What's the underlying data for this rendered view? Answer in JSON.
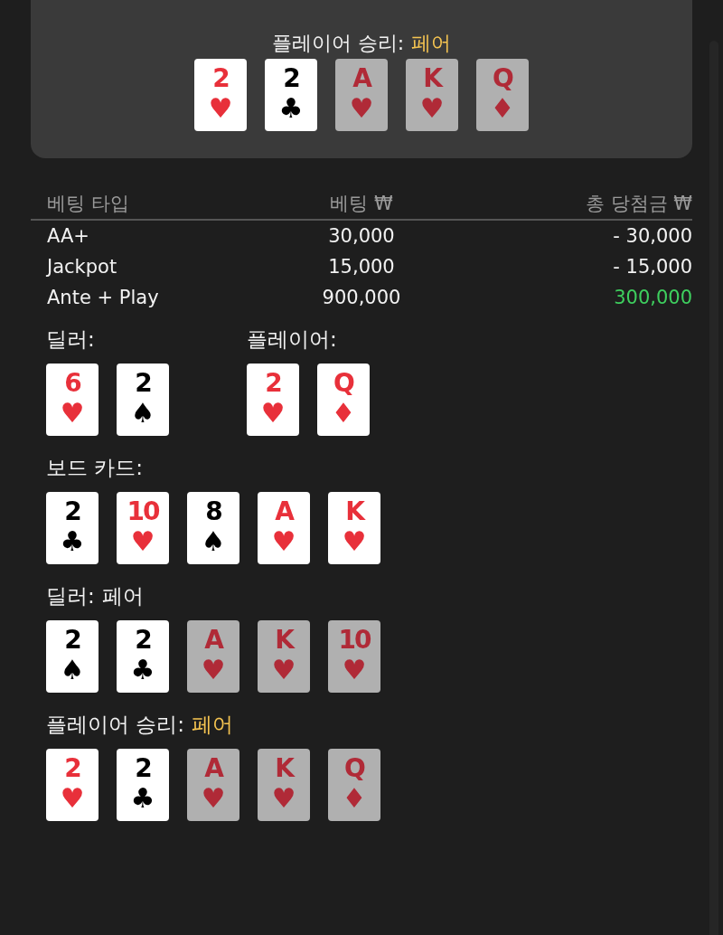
{
  "result_panel": {
    "label": "플레이어 승리:",
    "hand": "페어",
    "cards": [
      {
        "rank": "2",
        "suit": "♥",
        "red": true,
        "dimmed": false
      },
      {
        "rank": "2",
        "suit": "♣",
        "red": false,
        "dimmed": false
      },
      {
        "rank": "A",
        "suit": "♥",
        "red": true,
        "dimmed": true
      },
      {
        "rank": "K",
        "suit": "♥",
        "red": true,
        "dimmed": true
      },
      {
        "rank": "Q",
        "suit": "♦",
        "red": true,
        "dimmed": true
      }
    ]
  },
  "bets_table": {
    "columns": [
      "베팅 타입",
      "베팅 ₩",
      "총 당첨금 ₩"
    ],
    "rows": [
      {
        "type": "AA+",
        "bet": "30,000",
        "payout": "- 30,000",
        "color": "#f2f2f2"
      },
      {
        "type": "Jackpot",
        "bet": "15,000",
        "payout": "- 15,000",
        "color": "#f2f2f2"
      },
      {
        "type": "Ante + Play",
        "bet": "900,000",
        "payout": "300,000",
        "color": "#3ecf5e"
      }
    ]
  },
  "hands": [
    {
      "label": "딜러:",
      "cards": [
        {
          "rank": "6",
          "suit": "♥",
          "red": true,
          "dimmed": false
        },
        {
          "rank": "2",
          "suit": "♠",
          "red": false,
          "dimmed": false
        }
      ]
    },
    {
      "label": "플레이어:",
      "cards": [
        {
          "rank": "2",
          "suit": "♥",
          "red": true,
          "dimmed": false
        },
        {
          "rank": "Q",
          "suit": "♦",
          "red": true,
          "dimmed": false
        }
      ]
    }
  ],
  "sections": [
    {
      "label": "보드 카드:",
      "cards": [
        {
          "rank": "2",
          "suit": "♣",
          "red": false,
          "dimmed": false
        },
        {
          "rank": "10",
          "suit": "♥",
          "red": true,
          "dimmed": false
        },
        {
          "rank": "8",
          "suit": "♠",
          "red": false,
          "dimmed": false
        },
        {
          "rank": "A",
          "suit": "♥",
          "red": true,
          "dimmed": false
        },
        {
          "rank": "K",
          "suit": "♥",
          "red": true,
          "dimmed": false
        }
      ]
    },
    {
      "label": "딜러:",
      "hand": "페어",
      "highlight": false,
      "cards": [
        {
          "rank": "2",
          "suit": "♠",
          "red": false,
          "dimmed": false
        },
        {
          "rank": "2",
          "suit": "♣",
          "red": false,
          "dimmed": false
        },
        {
          "rank": "A",
          "suit": "♥",
          "red": true,
          "dimmed": true
        },
        {
          "rank": "K",
          "suit": "♥",
          "red": true,
          "dimmed": true
        },
        {
          "rank": "10",
          "suit": "♥",
          "red": true,
          "dimmed": true
        }
      ]
    },
    {
      "label": "플레이어 승리:",
      "hand": "페어",
      "highlight": true,
      "cards": [
        {
          "rank": "2",
          "suit": "♥",
          "red": true,
          "dimmed": false
        },
        {
          "rank": "2",
          "suit": "♣",
          "red": false,
          "dimmed": false
        },
        {
          "rank": "A",
          "suit": "♥",
          "red": true,
          "dimmed": true
        },
        {
          "rank": "K",
          "suit": "♥",
          "red": true,
          "dimmed": true
        },
        {
          "rank": "Q",
          "suit": "♦",
          "red": true,
          "dimmed": true
        }
      ]
    }
  ]
}
